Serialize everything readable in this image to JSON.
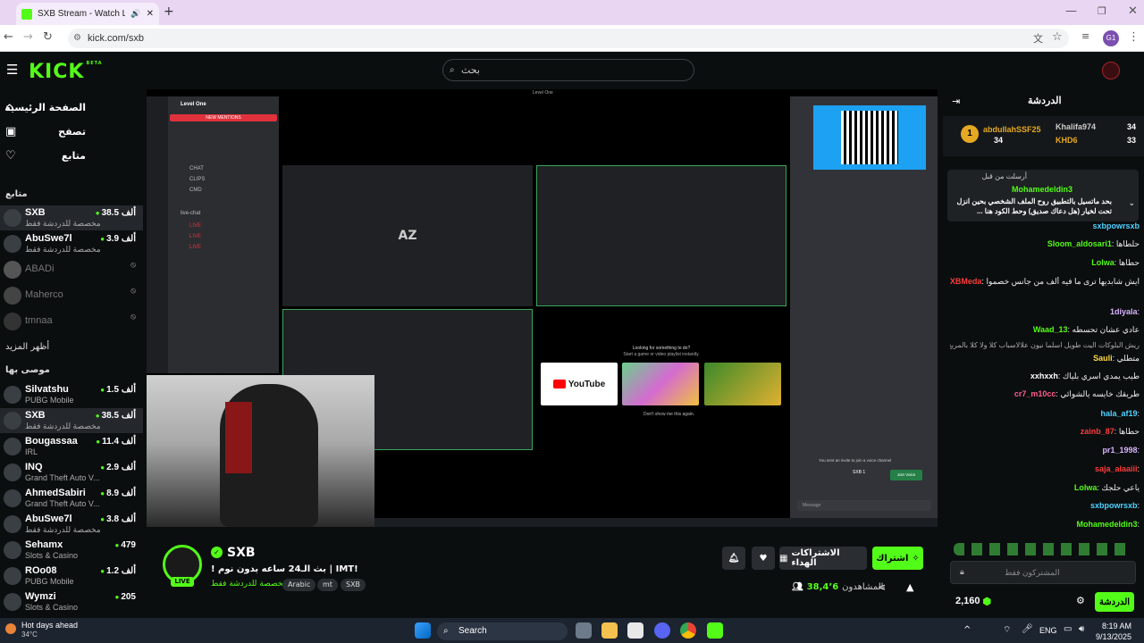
{
  "browser": {
    "tab_title": "SXB Stream - Watch Live on",
    "new_tab": "+",
    "url": "kick.com/sxb",
    "profile": "G1"
  },
  "header": {
    "logo": "KICK",
    "logo_badge": "BETA",
    "search_placeholder": "بحث"
  },
  "sidebar": {
    "nav": [
      {
        "label": "الصفحة الرئيسية",
        "icon": "home-icon"
      },
      {
        "label": "تصفح",
        "icon": "browse-icon"
      },
      {
        "label": "متابع",
        "icon": "heart-icon"
      }
    ],
    "following_title": "متابع",
    "following": [
      {
        "name": "SXB",
        "sub": "مخصصة للدردشة فقط",
        "viewers": "38.5 ألف",
        "active": true,
        "live": true
      },
      {
        "name": "AbuSwe7l",
        "sub": "مخصصة للدردشة فقط",
        "viewers": "3.9 ألف",
        "live": true
      },
      {
        "name": "ABADi",
        "live": false
      },
      {
        "name": "Maherco",
        "live": false
      },
      {
        "name": "tmnaa",
        "live": false
      }
    ],
    "show_more": "أظهر المزيد",
    "recommended_title": "موصى بها",
    "recommended": [
      {
        "name": "Silvatshu",
        "sub": "PUBG Mobile",
        "viewers": "1.5 ألف"
      },
      {
        "name": "SXB",
        "sub": "مخصصة للدردشة فقط",
        "viewers": "38.5 ألف",
        "active": true
      },
      {
        "name": "Bougassaa",
        "sub": "IRL",
        "viewers": "11.4 ألف"
      },
      {
        "name": "INQ",
        "sub": "Grand Theft Auto V...",
        "viewers": "2.9 ألف"
      },
      {
        "name": "AhmedSabiri",
        "sub": "Grand Theft Auto V...",
        "viewers": "8.9 ألف"
      },
      {
        "name": "AbuSwe7l",
        "sub": "مخصصة للدردشة فقط",
        "viewers": "3.8 ألف"
      },
      {
        "name": "Sehamx",
        "sub": "Slots & Casino",
        "viewers": "479"
      },
      {
        "name": "ROo08",
        "sub": "PUBG Mobile",
        "viewers": "1.2 ألف"
      },
      {
        "name": "Wymzi",
        "sub": "Slots & Casino",
        "viewers": "205"
      }
    ]
  },
  "video": {
    "discord_server": "Level One",
    "mentions_button": "NEW MENTIONS",
    "channels": [
      "CHAT",
      "CLIPS",
      "CMD",
      "live-chat",
      "LIVE",
      "LIVE",
      "LIVE"
    ],
    "right_panel_title": "Level One",
    "watch_prompt": "Looking for something to do?",
    "watch_prompt_sub": "Start a game or video playlist instantly.",
    "youtube": "YouTube",
    "dont_show": "Don't show me this again.",
    "dm_text": "You sent an invite to join a voice channel",
    "dm_user": "SXB 1",
    "join_button": "Join Voice",
    "message_placeholder": "Message"
  },
  "stream": {
    "channel": "SXB",
    "live_badge": "LIVE",
    "title": "! بث الـ24 ساعه بدون نوم | IMT!",
    "category": "مخصصة للدردشة فقط",
    "tags": [
      "Arabic",
      "mt",
      "SXB"
    ],
    "subscribe": "اشتراك",
    "gift_subs": "الاشتراكات الهداء",
    "viewers_label": "المشاهدون",
    "viewers": "38,4٬6"
  },
  "chat": {
    "title": "الدردشة",
    "leaderboard": [
      {
        "name": "abdullahSSF25",
        "value": "34",
        "rank": "1"
      },
      {
        "name": "Khalifa974",
        "value": "34"
      },
      {
        "name": "KHD6",
        "value": "33"
      }
    ],
    "pinned_header": "أرسلت من قبل",
    "pinned_user": "Mohamedeldin3",
    "pinned_text": "بحد ماتسيل بالتطبيق روح الملف الشخصي بحين انزل تحت لخيار (هل دعاك صديق) وحط الكود هنا ...",
    "messages": [
      {
        "user": "sxbpowrsxb",
        "text": ""
      },
      {
        "user": "Sloom_aldosari1",
        "text": "حلطاها",
        "color": "#53fc18"
      },
      {
        "user": "Lolwa",
        "text": "حطاها",
        "color": "#53fc18"
      },
      {
        "user": "SXBMeda",
        "text": "ايش شابديها ترى ما فيه ألف من جانس خصموا",
        "color": "#ff3b3b"
      },
      {
        "user": "1diyala",
        "text": "",
        "color": "#d9b3ff"
      },
      {
        "user": "Waad_13",
        "text": "عادي عشان تحسطه",
        "color": "#53fc18"
      },
      {
        "user": "",
        "text": "ريش البلوكات اليت طويل اسلما نيون علالاسباب كلا ولا كلا بالمربع ...",
        "color": "#aaa"
      },
      {
        "user": "Sauli",
        "text": "متطلي",
        "color": "#ffd84a"
      },
      {
        "user": "xxhxxh",
        "text": "طيب يمدي اسري بلياك",
        "color": "#ffffff"
      },
      {
        "user": "cr7_m10cc",
        "text": "طريقك خايسه يالشوائي",
        "color": "#ff5c8a"
      },
      {
        "user": "hala_af19",
        "text": "",
        "color": "#4fd1ff"
      },
      {
        "user": "zainb_87",
        "text": "حطاها",
        "color": "#ff3b3b"
      },
      {
        "user": "pr1_1998",
        "text": "",
        "color": "#d9b3ff"
      },
      {
        "user": "saja_alaaiii",
        "text": "",
        "color": "#ff3b3b"
      },
      {
        "user": "Lolwa",
        "text": "ياعي حلجك",
        "color": "#53fc18"
      },
      {
        "user": "sxbpowrsxb",
        "text": "",
        "color": "#4fd1ff"
      },
      {
        "user": "Mohamedeldin3",
        "text": "",
        "color": "#53fc18"
      }
    ],
    "input_placeholder": "المشتركون فقط",
    "points": "2,160",
    "send": "الدردشة"
  },
  "taskbar": {
    "weather_title": "Hot days ahead",
    "weather_temp": "34°C",
    "search": "Search",
    "lang": "ENG",
    "time": "8:19 AM",
    "date": "9/13/2025"
  },
  "colors": {
    "accent": "#53fc18",
    "bg": "#0b0e0f"
  }
}
